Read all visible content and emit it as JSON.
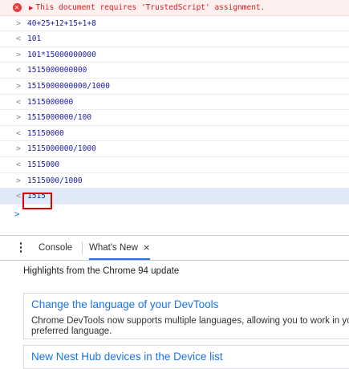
{
  "console": {
    "error_text": "This document requires 'TrustedScript' assignment.",
    "entries": [
      {
        "kind": "input",
        "text": "40+25+12+15+1+8"
      },
      {
        "kind": "output",
        "text": "101"
      },
      {
        "kind": "input",
        "text": "101*15000000000"
      },
      {
        "kind": "output",
        "text": "1515000000000"
      },
      {
        "kind": "input",
        "text": "1515000000000/1000"
      },
      {
        "kind": "output",
        "text": "1515000000"
      },
      {
        "kind": "input",
        "text": "1515000000/100"
      },
      {
        "kind": "output",
        "text": "15150000"
      },
      {
        "kind": "input",
        "text": "1515000000/1000"
      },
      {
        "kind": "output",
        "text": "1515000"
      },
      {
        "kind": "input",
        "text": "1515000/1000"
      },
      {
        "kind": "output",
        "text": "1515"
      }
    ],
    "input_glyph": ">",
    "output_glyph": "<",
    "prompt_glyph": ">"
  },
  "drawer": {
    "tabs": [
      {
        "label": "Console"
      },
      {
        "label": "What's New",
        "close": "×"
      }
    ],
    "highlights": "Highlights from the Chrome 94 update",
    "cards": [
      {
        "title": "Change the language of your DevTools",
        "body": "Chrome DevTools now supports multiple languages, allowing you to work in your preferred language."
      },
      {
        "title": "New Nest Hub devices in the Device list",
        "body": ""
      }
    ]
  },
  "colors": {
    "accent": "#1a73e8",
    "error": "#e0191f",
    "highlight_box": "#e00000",
    "value_text": "#1a1aa6"
  }
}
